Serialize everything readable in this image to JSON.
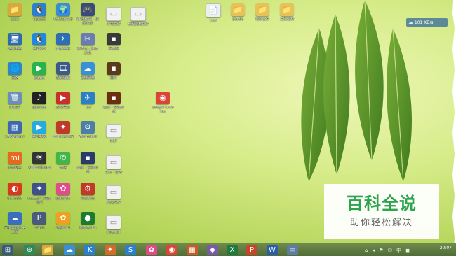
{
  "desktop": {
    "icons": [
      {
        "label": "aaaa",
        "glyph": "📁",
        "color": "#d7a93a"
      },
      {
        "label": "QQ游戏",
        "glyph": "🐧",
        "color": "#2a7fd1"
      },
      {
        "label": "FotoSpeed",
        "glyph": "🌍",
        "color": "#3b8dd0"
      },
      {
        "label": "KK录像机 - 快捷方式",
        "glyph": "🎮",
        "color": "#3a4b7a"
      },
      {
        "label": "本书文件",
        "glyph": "▭",
        "color": "#f1f1f1"
      },
      {
        "label": "教程素材文件",
        "glyph": "▭",
        "color": "#f1f1f1"
      },
      {
        "label": "打开",
        "glyph": "📄",
        "color": "#eeeeee"
      },
      {
        "label": "Studio",
        "glyph": "📁",
        "color": "#e4c35a"
      },
      {
        "label": "制作文件",
        "glyph": "📁",
        "color": "#e4c35a"
      },
      {
        "label": "主页素材",
        "glyph": "📁",
        "color": "#e4c35a"
      },
      {
        "label": "这台电脑",
        "glyph": "🖥",
        "color": "#2d6bb0"
      },
      {
        "label": "腾讯QQ",
        "glyph": "🐧",
        "color": "#1e88e5"
      },
      {
        "label": "数学实验",
        "glyph": "Σ",
        "color": "#2c6fb5"
      },
      {
        "label": "爱奇艺 - 快捷方式",
        "glyph": "✂",
        "color": "#6b7cb0"
      },
      {
        "label": "百度图",
        "glyph": "▪",
        "color": "#3a3a3a"
      },
      {
        "label": "网络",
        "glyph": "🌐",
        "color": "#2c86c9"
      },
      {
        "label": "爱奇艺",
        "glyph": "▶",
        "color": "#29b34b"
      },
      {
        "label": "视频编辑",
        "glyph": "🎞",
        "color": "#3c5a8a"
      },
      {
        "label": "百度网盘",
        "glyph": "☁",
        "color": "#3a90d6"
      },
      {
        "label": "图片",
        "glyph": "▪",
        "color": "#5b3b1b"
      },
      {
        "label": "回收站",
        "glyph": "🗑",
        "color": "#6b8fb8"
      },
      {
        "label": "酷狗音乐",
        "glyph": "♪",
        "color": "#222222"
      },
      {
        "label": "影音先锋",
        "glyph": "▶",
        "color": "#c9302c"
      },
      {
        "label": "飞行",
        "glyph": "✈",
        "color": "#2c7fc4"
      },
      {
        "label": "截图 - 快捷方式",
        "glyph": "▪",
        "color": "#6a2f10"
      },
      {
        "label": "Google Chrome",
        "glyph": "◉",
        "color": "#db4437"
      },
      {
        "label": "CADViewer",
        "glyph": "▦",
        "color": "#3e68b0"
      },
      {
        "label": "腾讯视频",
        "glyph": "▶",
        "color": "#27a9e1"
      },
      {
        "label": "CS1.6中文版",
        "glyph": "✦",
        "color": "#c03a2b"
      },
      {
        "label": "WKworkUI",
        "glyph": "⚙",
        "color": "#4e7da8"
      },
      {
        "label": "打开",
        "glyph": "▭",
        "color": "#f1f1f1"
      },
      {
        "label": "小米助手",
        "glyph": "mi",
        "color": "#e56a1f"
      },
      {
        "label": "AudioWizard",
        "glyph": "≋",
        "color": "#333333"
      },
      {
        "label": "微信",
        "glyph": "✆",
        "color": "#43b649"
      },
      {
        "label": "聚星 - 快捷方式",
        "glyph": "▪",
        "color": "#2a3b6a"
      },
      {
        "label": "打开 - 副本",
        "glyph": "▭",
        "color": "#f1f1f1"
      },
      {
        "label": "Ulinkder",
        "glyph": "◐",
        "color": "#d9381e"
      },
      {
        "label": "dosbox - 快捷方式",
        "glyph": "✦",
        "color": "#3f4f8a"
      },
      {
        "label": "酷我音乐",
        "glyph": "✿",
        "color": "#e14d8c"
      },
      {
        "label": "驱动精灵",
        "glyph": "⚙",
        "color": "#c0392b"
      },
      {
        "label": "新建文件",
        "glyph": "▭",
        "color": "#f1f1f1"
      },
      {
        "label": "百度云管家第二版",
        "glyph": "☁",
        "color": "#3a6fc0"
      },
      {
        "label": "Graph",
        "glyph": "P",
        "color": "#4a5a7a"
      },
      {
        "label": "动画工具",
        "glyph": "✿",
        "color": "#f0a020"
      },
      {
        "label": "爱奇艺PPS",
        "glyph": "●",
        "color": "#1d7a2e"
      },
      {
        "label": "新建文件",
        "glyph": "▭",
        "color": "#f1f1f1"
      }
    ]
  },
  "netspeed": {
    "text": "101 KB/s",
    "icon": "cloud-icon"
  },
  "watermark": {
    "title": "百科全说",
    "subtitle": "助你轻松解决"
  },
  "taskbar": {
    "buttons": [
      {
        "name": "start",
        "glyph": "⊞",
        "color": "#3a5a7a"
      },
      {
        "name": "app-1",
        "glyph": "⊕",
        "color": "#2e8b57"
      },
      {
        "name": "explorer",
        "glyph": "📁",
        "color": "#d8a838"
      },
      {
        "name": "baidu",
        "glyph": "☁",
        "color": "#3a90d6"
      },
      {
        "name": "kugou",
        "glyph": "K",
        "color": "#2a7fd1"
      },
      {
        "name": "app-5",
        "glyph": "✦",
        "color": "#d36a2a"
      },
      {
        "name": "sogou",
        "glyph": "S",
        "color": "#2a7fd1"
      },
      {
        "name": "app-7",
        "glyph": "✿",
        "color": "#e04a8a"
      },
      {
        "name": "chrome",
        "glyph": "◉",
        "color": "#db4437"
      },
      {
        "name": "app-9",
        "glyph": "▦",
        "color": "#c95a2a"
      },
      {
        "name": "app-10",
        "glyph": "◆",
        "color": "#7a5aa8"
      },
      {
        "name": "excel",
        "glyph": "X",
        "color": "#1f7a3f"
      },
      {
        "name": "powerpoint",
        "glyph": "P",
        "color": "#c9452a"
      },
      {
        "name": "word",
        "glyph": "W",
        "color": "#2b5fa8"
      },
      {
        "name": "app-14",
        "glyph": "▭",
        "color": "#5f7ba0"
      }
    ],
    "tray": "⌂ ◂ ⚑ ✉ 中 ◼",
    "clock": "20:07"
  }
}
